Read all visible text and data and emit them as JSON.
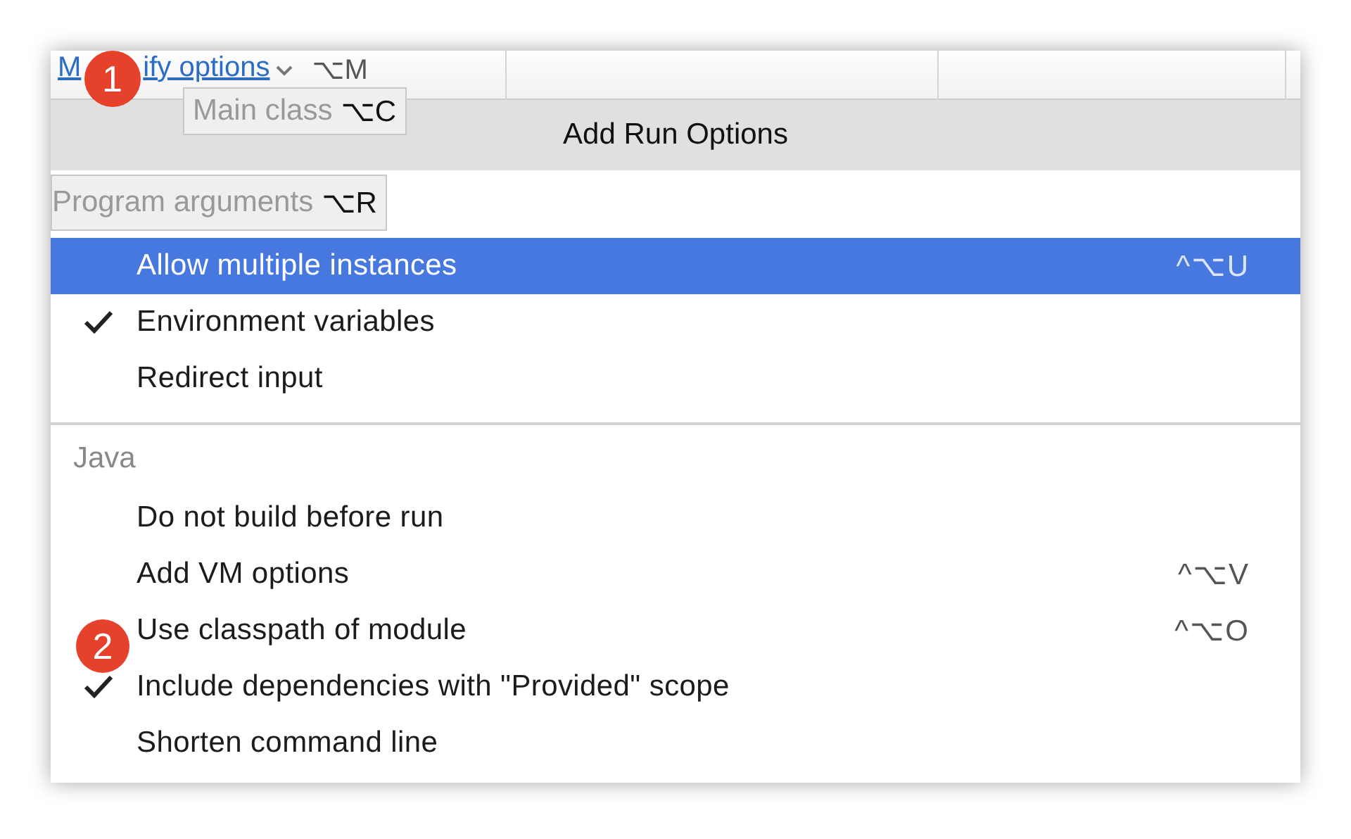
{
  "link": {
    "text_parts": [
      "M",
      "ify options"
    ],
    "shortcut": "⌥M"
  },
  "tooltips": [
    {
      "label": "Main class",
      "shortcut": "⌥C"
    },
    {
      "label": "Program arguments",
      "shortcut": "⌥R"
    }
  ],
  "popup": {
    "title": "Add Run Options"
  },
  "sections": [
    {
      "items": [
        {
          "label": "Allow multiple instances",
          "shortcut": "^⌥U",
          "checked": false,
          "selected": true
        },
        {
          "label": "Environment variables",
          "checked": true,
          "selected": false
        },
        {
          "label": "Redirect input",
          "checked": false,
          "selected": false
        }
      ]
    },
    {
      "header": "Java",
      "items": [
        {
          "label": "Do not build before run",
          "checked": false,
          "selected": false
        },
        {
          "label": "Add VM options",
          "shortcut": "^⌥V",
          "checked": false,
          "selected": false
        },
        {
          "label": "Use classpath of module",
          "shortcut": "^⌥O",
          "checked": false,
          "selected": false
        },
        {
          "label": "Include dependencies with \"Provided\" scope",
          "checked": true,
          "selected": false
        },
        {
          "label": "Shorten command line",
          "checked": false,
          "selected": false
        }
      ]
    }
  ],
  "annotations": [
    "1",
    "2"
  ]
}
